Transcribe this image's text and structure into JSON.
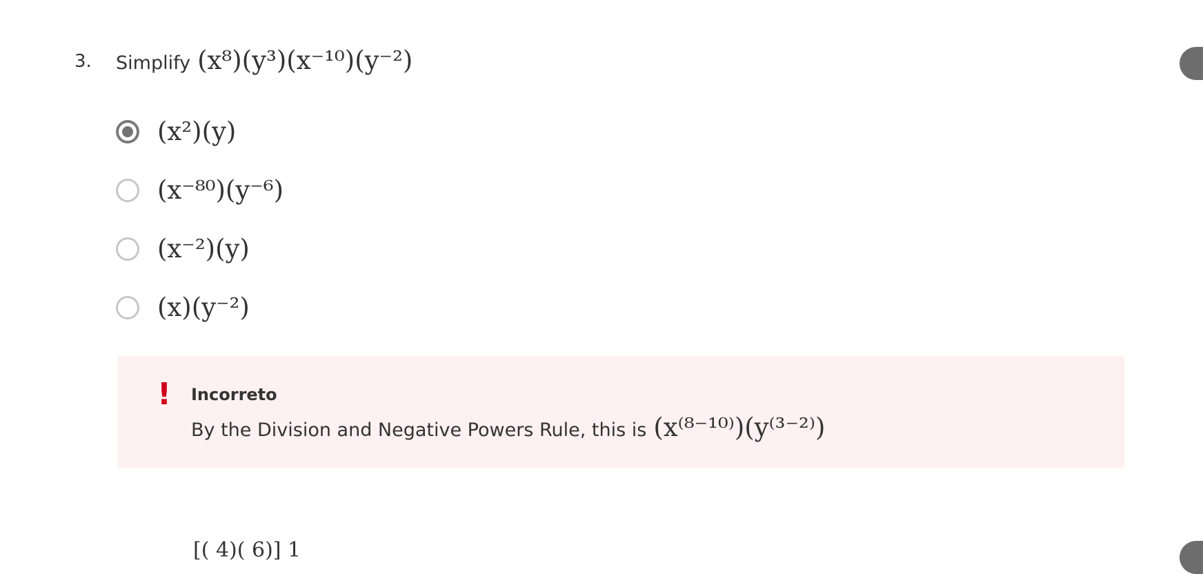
{
  "question": {
    "number": "3.",
    "prompt": "Simplify",
    "expression": "(x⁸)(y³)(x⁻¹⁰)(y⁻²)"
  },
  "options": [
    {
      "label": "(x²)(y)",
      "selected": true
    },
    {
      "label": "(x⁻⁸⁰)(y⁻⁶)",
      "selected": false
    },
    {
      "label": "(x⁻²)(y)",
      "selected": false
    },
    {
      "label": "(x)(y⁻²)",
      "selected": false
    }
  ],
  "feedback": {
    "icon": "!",
    "status": "Incorreto",
    "explanation": "By the Division and Negative Powers Rule, this is",
    "expression": "(x⁽⁸⁻¹⁰⁾)(y⁽³⁻²⁾)"
  },
  "next_question_preview": "[(    4)(    6)]    1",
  "colors": {
    "error_red": "#d0021b",
    "feedback_bg": "#fdf1f2",
    "radio_selected": "#737373",
    "radio_unselected": "#c7c7c7",
    "side_tab": "#6d6d6d"
  },
  "icons": {
    "selected_radio": "radio-selected-icon",
    "unselected_radio": "radio-unselected-icon",
    "error": "exclamation-icon"
  }
}
